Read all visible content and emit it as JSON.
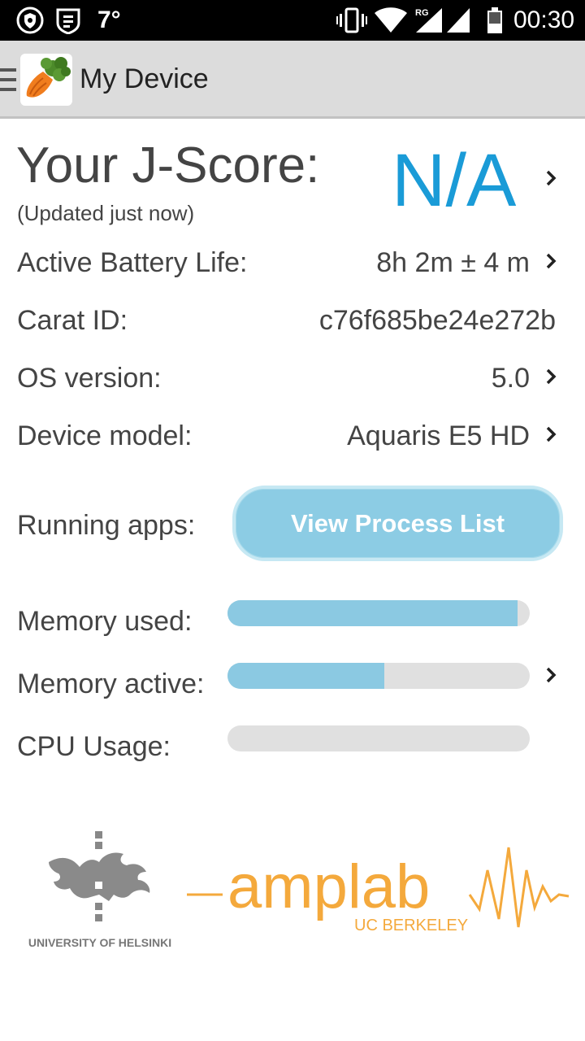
{
  "status_bar": {
    "temperature": "7°",
    "network_label": "RG",
    "time": "00:30"
  },
  "action_bar": {
    "title": "My Device",
    "menu_icon": "hamburger-icon",
    "app_icon": "carrot-icon"
  },
  "jscore": {
    "title": "Your J-Score:",
    "updated": "(Updated just now)",
    "value": "N/A"
  },
  "rows": {
    "battery": {
      "label": "Active Battery Life:",
      "value": "8h 2m ± 4 m"
    },
    "carat_id": {
      "label": "Carat ID:",
      "value": "c76f685be24e272b"
    },
    "os": {
      "label": "OS version:",
      "value": "5.0"
    },
    "device": {
      "label": "Device model:",
      "value": "Aquaris E5 HD"
    }
  },
  "running_apps": {
    "label": "Running apps:",
    "button_label": "View Process List"
  },
  "meters": {
    "memory_used": {
      "label": "Memory used:",
      "fraction": 0.96
    },
    "memory_active": {
      "label": "Memory active:",
      "fraction": 0.52
    },
    "cpu_usage": {
      "label": "CPU Usage:",
      "fraction": 0.0
    }
  },
  "logos": {
    "helsinki": "UNIVERSITY OF HELSINKI",
    "amplab": "amplab",
    "berkeley": "UC BERKELEY"
  },
  "colors": {
    "accent": "#1a9bd7",
    "bar_fill": "#8bc9e2",
    "button": "#8ccce4"
  }
}
